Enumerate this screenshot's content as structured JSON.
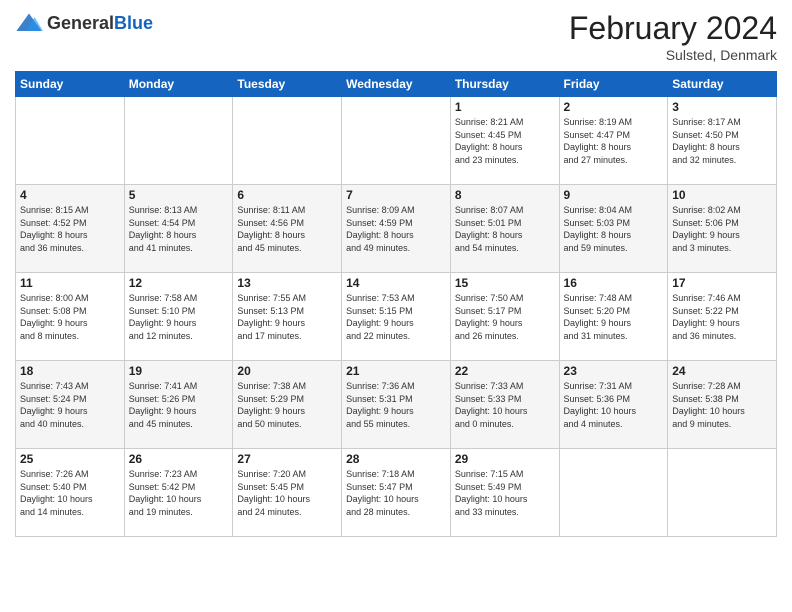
{
  "header": {
    "logo_general": "General",
    "logo_blue": "Blue",
    "month_title": "February 2024",
    "location": "Sulsted, Denmark"
  },
  "days_of_week": [
    "Sunday",
    "Monday",
    "Tuesday",
    "Wednesday",
    "Thursday",
    "Friday",
    "Saturday"
  ],
  "weeks": [
    [
      {
        "day": "",
        "info": ""
      },
      {
        "day": "",
        "info": ""
      },
      {
        "day": "",
        "info": ""
      },
      {
        "day": "",
        "info": ""
      },
      {
        "day": "1",
        "info": "Sunrise: 8:21 AM\nSunset: 4:45 PM\nDaylight: 8 hours\nand 23 minutes."
      },
      {
        "day": "2",
        "info": "Sunrise: 8:19 AM\nSunset: 4:47 PM\nDaylight: 8 hours\nand 27 minutes."
      },
      {
        "day": "3",
        "info": "Sunrise: 8:17 AM\nSunset: 4:50 PM\nDaylight: 8 hours\nand 32 minutes."
      }
    ],
    [
      {
        "day": "4",
        "info": "Sunrise: 8:15 AM\nSunset: 4:52 PM\nDaylight: 8 hours\nand 36 minutes."
      },
      {
        "day": "5",
        "info": "Sunrise: 8:13 AM\nSunset: 4:54 PM\nDaylight: 8 hours\nand 41 minutes."
      },
      {
        "day": "6",
        "info": "Sunrise: 8:11 AM\nSunset: 4:56 PM\nDaylight: 8 hours\nand 45 minutes."
      },
      {
        "day": "7",
        "info": "Sunrise: 8:09 AM\nSunset: 4:59 PM\nDaylight: 8 hours\nand 49 minutes."
      },
      {
        "day": "8",
        "info": "Sunrise: 8:07 AM\nSunset: 5:01 PM\nDaylight: 8 hours\nand 54 minutes."
      },
      {
        "day": "9",
        "info": "Sunrise: 8:04 AM\nSunset: 5:03 PM\nDaylight: 8 hours\nand 59 minutes."
      },
      {
        "day": "10",
        "info": "Sunrise: 8:02 AM\nSunset: 5:06 PM\nDaylight: 9 hours\nand 3 minutes."
      }
    ],
    [
      {
        "day": "11",
        "info": "Sunrise: 8:00 AM\nSunset: 5:08 PM\nDaylight: 9 hours\nand 8 minutes."
      },
      {
        "day": "12",
        "info": "Sunrise: 7:58 AM\nSunset: 5:10 PM\nDaylight: 9 hours\nand 12 minutes."
      },
      {
        "day": "13",
        "info": "Sunrise: 7:55 AM\nSunset: 5:13 PM\nDaylight: 9 hours\nand 17 minutes."
      },
      {
        "day": "14",
        "info": "Sunrise: 7:53 AM\nSunset: 5:15 PM\nDaylight: 9 hours\nand 22 minutes."
      },
      {
        "day": "15",
        "info": "Sunrise: 7:50 AM\nSunset: 5:17 PM\nDaylight: 9 hours\nand 26 minutes."
      },
      {
        "day": "16",
        "info": "Sunrise: 7:48 AM\nSunset: 5:20 PM\nDaylight: 9 hours\nand 31 minutes."
      },
      {
        "day": "17",
        "info": "Sunrise: 7:46 AM\nSunset: 5:22 PM\nDaylight: 9 hours\nand 36 minutes."
      }
    ],
    [
      {
        "day": "18",
        "info": "Sunrise: 7:43 AM\nSunset: 5:24 PM\nDaylight: 9 hours\nand 40 minutes."
      },
      {
        "day": "19",
        "info": "Sunrise: 7:41 AM\nSunset: 5:26 PM\nDaylight: 9 hours\nand 45 minutes."
      },
      {
        "day": "20",
        "info": "Sunrise: 7:38 AM\nSunset: 5:29 PM\nDaylight: 9 hours\nand 50 minutes."
      },
      {
        "day": "21",
        "info": "Sunrise: 7:36 AM\nSunset: 5:31 PM\nDaylight: 9 hours\nand 55 minutes."
      },
      {
        "day": "22",
        "info": "Sunrise: 7:33 AM\nSunset: 5:33 PM\nDaylight: 10 hours\nand 0 minutes."
      },
      {
        "day": "23",
        "info": "Sunrise: 7:31 AM\nSunset: 5:36 PM\nDaylight: 10 hours\nand 4 minutes."
      },
      {
        "day": "24",
        "info": "Sunrise: 7:28 AM\nSunset: 5:38 PM\nDaylight: 10 hours\nand 9 minutes."
      }
    ],
    [
      {
        "day": "25",
        "info": "Sunrise: 7:26 AM\nSunset: 5:40 PM\nDaylight: 10 hours\nand 14 minutes."
      },
      {
        "day": "26",
        "info": "Sunrise: 7:23 AM\nSunset: 5:42 PM\nDaylight: 10 hours\nand 19 minutes."
      },
      {
        "day": "27",
        "info": "Sunrise: 7:20 AM\nSunset: 5:45 PM\nDaylight: 10 hours\nand 24 minutes."
      },
      {
        "day": "28",
        "info": "Sunrise: 7:18 AM\nSunset: 5:47 PM\nDaylight: 10 hours\nand 28 minutes."
      },
      {
        "day": "29",
        "info": "Sunrise: 7:15 AM\nSunset: 5:49 PM\nDaylight: 10 hours\nand 33 minutes."
      },
      {
        "day": "",
        "info": ""
      },
      {
        "day": "",
        "info": ""
      }
    ]
  ]
}
